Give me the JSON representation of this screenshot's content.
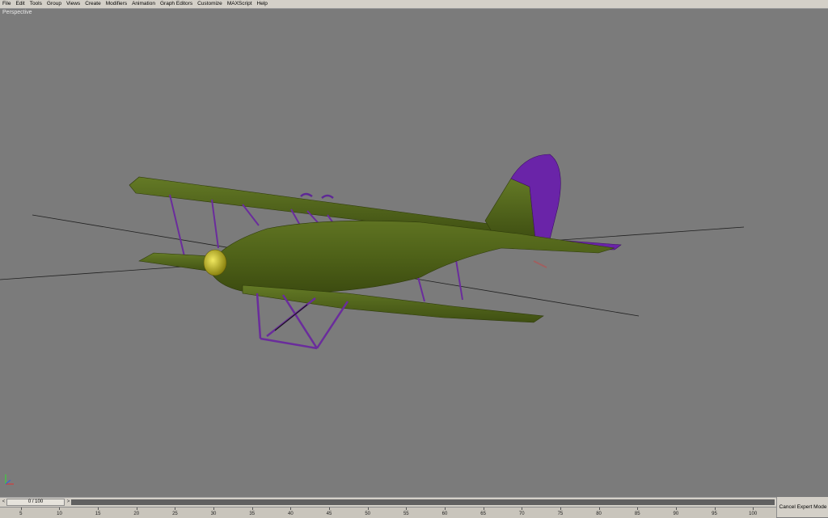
{
  "menu": {
    "items": [
      "File",
      "Edit",
      "Tools",
      "Group",
      "Views",
      "Create",
      "Modifiers",
      "Animation",
      "Graph Editors",
      "Customize",
      "MAXScript",
      "Help"
    ]
  },
  "viewport": {
    "label": "Perspective"
  },
  "axis": {
    "x_label": "x",
    "y_label": "y"
  },
  "timebar": {
    "slider_label": "0 / 100",
    "left_arrow": "<",
    "right_arrow": ">"
  },
  "ruler": {
    "ticks": [
      "5",
      "10",
      "15",
      "20",
      "25",
      "30",
      "35",
      "40",
      "45",
      "50",
      "55",
      "60",
      "65",
      "70",
      "75",
      "80",
      "85",
      "90",
      "95",
      "100"
    ]
  },
  "buttons": {
    "cancel_expert": "Cancel Expert Mode"
  },
  "colors": {
    "viewport_bg": "#7b7b7b",
    "fuselage": "#5a6b1e",
    "wing": "#4f6019",
    "struts": "#6a2c9c",
    "tail_fin": "#6a24a8",
    "propeller_hub": "#c9c020"
  }
}
